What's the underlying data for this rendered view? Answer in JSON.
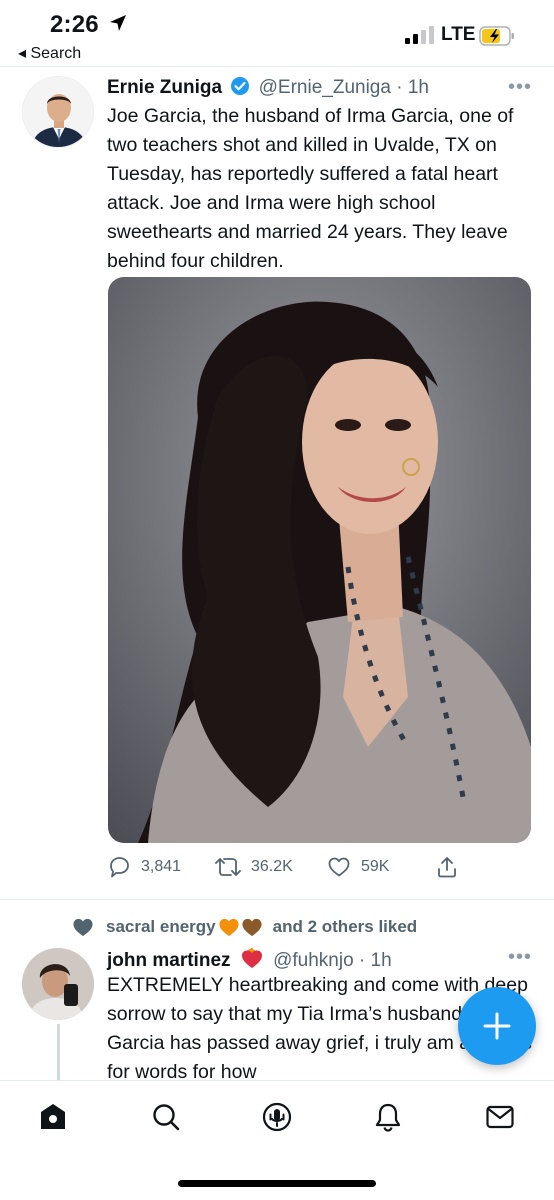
{
  "status_bar": {
    "time": "2:26",
    "back_label": "◂ Search",
    "network": "LTE",
    "location_icon": "location-arrow-icon",
    "signal_icon": "cellular-signal-icon",
    "battery_icon": "battery-charging-icon"
  },
  "tweet1": {
    "name": "Ernie Zuniga",
    "handle": "@Ernie_Zuniga",
    "separator": "·",
    "time": "1h",
    "more": "•••",
    "text": "Joe Garcia, the husband of Irma Garcia, one of two teachers shot and killed in Uvalde, TX on Tuesday, has reportedly suffered a fatal heart attack. Joe and Irma were high school sweethearts and married 24 years. They leave behind four children.",
    "verified_icon": "verified-badge-icon",
    "actions": {
      "replies": "3,841",
      "retweets": "36.2K",
      "likes": "59K"
    }
  },
  "tweet2": {
    "liked_prefix": "sacral energy",
    "liked_suffix": "and 2 others liked",
    "name": "john martinez",
    "handle": "@fuhknjo",
    "separator": "·",
    "time": "1h",
    "more": "•••",
    "text": "EXTREMELY heartbreaking and come with deep sorrow to say that my Tia Irma’s husband Joe Garcia has passed away grief, i truly am at a loss for words for how"
  },
  "tab_bar": {
    "tabs": [
      "home-icon",
      "search-icon",
      "spaces-icon",
      "notifications-icon",
      "messages-icon"
    ]
  },
  "colors": {
    "accent": "#1d9bf0",
    "text": "#0f1419",
    "secondary": "#536471"
  }
}
